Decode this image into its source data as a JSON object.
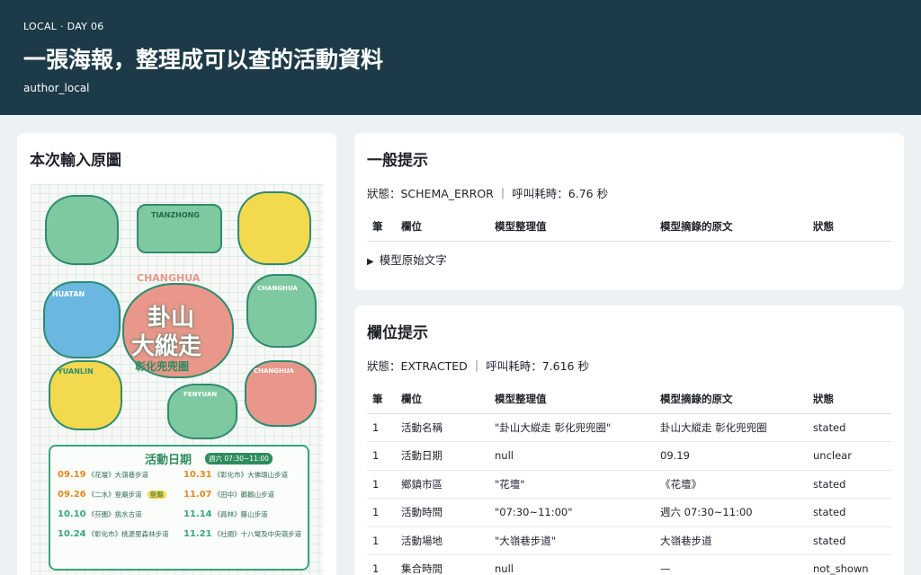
{
  "header": {
    "kicker": "LOCAL · DAY 06",
    "title": "一張海報，整理成可以查的活動資料",
    "author": "author_local"
  },
  "left_panel": {
    "title": "本次輸入原圖",
    "poster": {
      "top_labels": [
        "TIANZHONG",
        "CHANGHUA",
        "HUATAN",
        "CHANGHUA",
        "YUANLIN",
        "FENYUAN",
        "CHANGHUA"
      ],
      "main_title_line1": "卦山",
      "main_title_line2": "大縱走",
      "subtitle": "彰化兜兜圈",
      "event_title": "活動日期",
      "event_badge": "週六 07:30~11:00",
      "events": [
        {
          "date": "09.19",
          "text": "《花壇》大嶺巷步道"
        },
        {
          "date": "10.31",
          "text": "《彰化市》大佛環山步道"
        },
        {
          "date": "09.26",
          "text": "《二水》登廟步道"
        },
        {
          "date": "11.07",
          "text": "《田中》鵝鵝山步道"
        },
        {
          "date": "10.10",
          "text": "《芬園》挑水古道"
        },
        {
          "date": "11.14",
          "text": "《員林》藤山步道"
        },
        {
          "date": "10.24",
          "text": "《彰化市》桃源里森林步道"
        },
        {
          "date": "11.21",
          "text": "《社頭》十八彎及中央嶺步道"
        }
      ],
      "badge_extra": "登廟"
    }
  },
  "general": {
    "title": "一般提示",
    "status": "狀態：SCHEMA_ERROR ｜ 呼叫耗時：6.76 秒",
    "columns": [
      "筆",
      "欄位",
      "模型整理值",
      "模型摘錄的原文",
      "狀態"
    ],
    "details_label": "模型原始文字"
  },
  "field": {
    "title": "欄位提示",
    "status": "狀態：EXTRACTED ｜ 呼叫耗時：7.616 秒",
    "columns": [
      "筆",
      "欄位",
      "模型整理值",
      "模型摘錄的原文",
      "狀態"
    ],
    "rows": [
      [
        "1",
        "活動名稱",
        "\"卦山大縱走 彰化兜兜圈\"",
        "卦山大縱走 彰化兜兜圈",
        "stated"
      ],
      [
        "1",
        "活動日期",
        "null",
        "09.19",
        "unclear"
      ],
      [
        "1",
        "鄉鎮市區",
        "\"花壇\"",
        "《花壇》",
        "stated"
      ],
      [
        "1",
        "活動時間",
        "\"07:30~11:00\"",
        "週六 07:30~11:00",
        "stated"
      ],
      [
        "1",
        "活動場地",
        "\"大嶺巷步道\"",
        "大嶺巷步道",
        "stated"
      ],
      [
        "1",
        "集合時間",
        "null",
        "—",
        "not_shown"
      ]
    ]
  },
  "colors": {
    "header_bg": "#1c3a47",
    "poster_green": "#3aa57a",
    "poster_pink": "#e8978a",
    "poster_yellow": "#f2d94e",
    "poster_blue": "#6ab7e0"
  }
}
